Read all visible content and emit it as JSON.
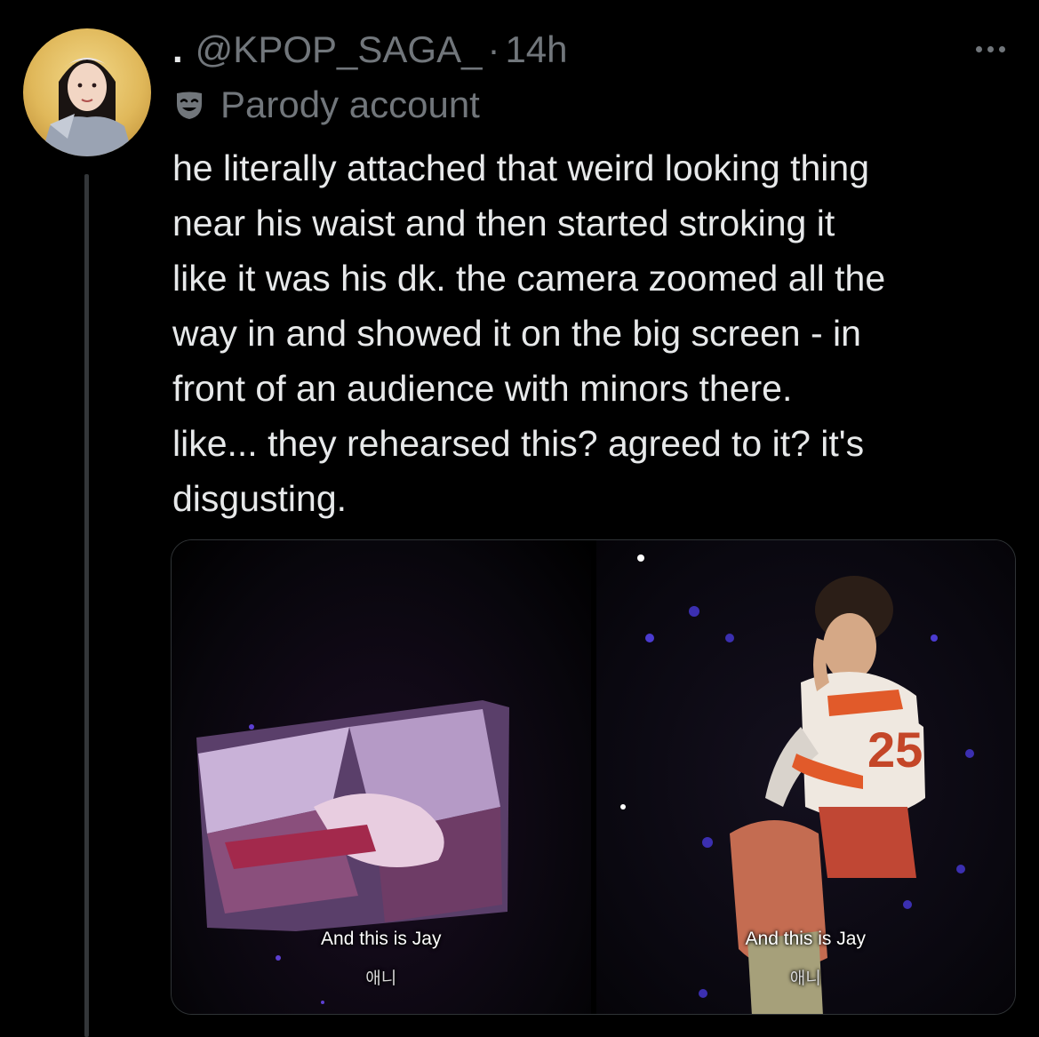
{
  "tweet": {
    "display_name": ".",
    "handle": "@KPOP_SAGA_",
    "separator": "·",
    "time": "14h",
    "label": "Parody account",
    "label_icon": "parody-mask-icon",
    "more_icon": "more-icon",
    "text_lines": [
      "he literally attached that weird looking thing",
      "near his waist and then started stroking it",
      "like it was his dk. the camera zoomed all the",
      "way in and showed it on the big screen - in",
      "front of an audience with minors there.",
      "like... they rehearsed this? agreed to it? it's",
      "disgusting."
    ]
  },
  "media": {
    "images": [
      {
        "caption": "And this is Jay",
        "subtitle": "애니"
      },
      {
        "caption": "And this is Jay",
        "subtitle": "애니",
        "jersey_number": "25"
      }
    ]
  },
  "colors": {
    "background": "#000000",
    "text": "#e7e9ea",
    "secondary": "#71767b",
    "border": "#2f3336",
    "avatar_bg": "#e0b85a"
  }
}
